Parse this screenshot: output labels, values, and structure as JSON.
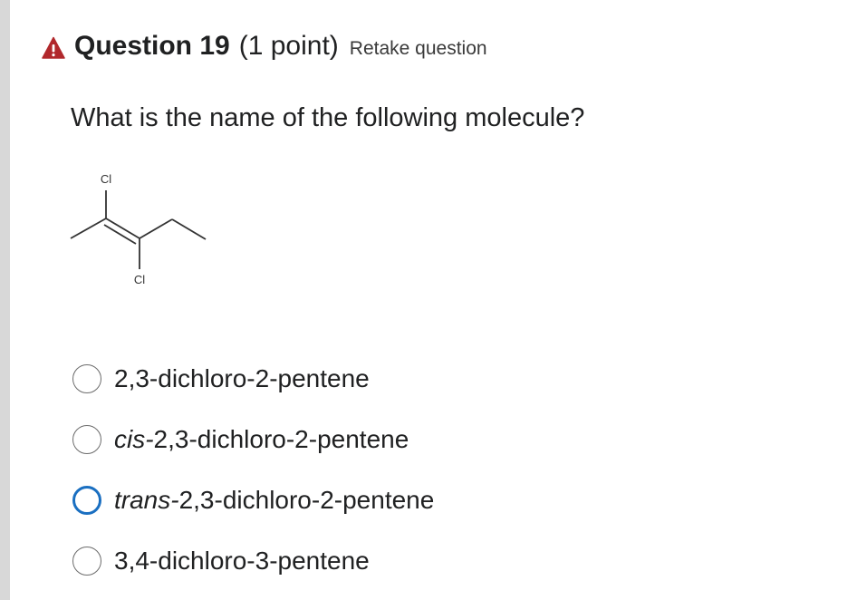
{
  "header": {
    "icon": "warning-icon",
    "icon_color": "#b1282c",
    "title": "Question 19",
    "points": "(1 point)",
    "retake_label": "Retake question"
  },
  "question": {
    "prompt": "What is the name of the following molecule?",
    "molecule": {
      "atom_labels": [
        "Cl",
        "Cl"
      ]
    }
  },
  "options": [
    {
      "prefix": "",
      "text": "2,3-dichloro-2-pentene",
      "selected": false
    },
    {
      "prefix": "cis-",
      "text": "2,3-dichloro-2-pentene",
      "selected": false
    },
    {
      "prefix": "trans-",
      "text": "2,3-dichloro-2-pentene",
      "selected": false,
      "focused": true
    },
    {
      "prefix": "",
      "text": "3,4-dichloro-3-pentene",
      "selected": false
    }
  ],
  "colors": {
    "focus_ring": "#1a6fc1",
    "radio_border": "#6b6b6b"
  }
}
